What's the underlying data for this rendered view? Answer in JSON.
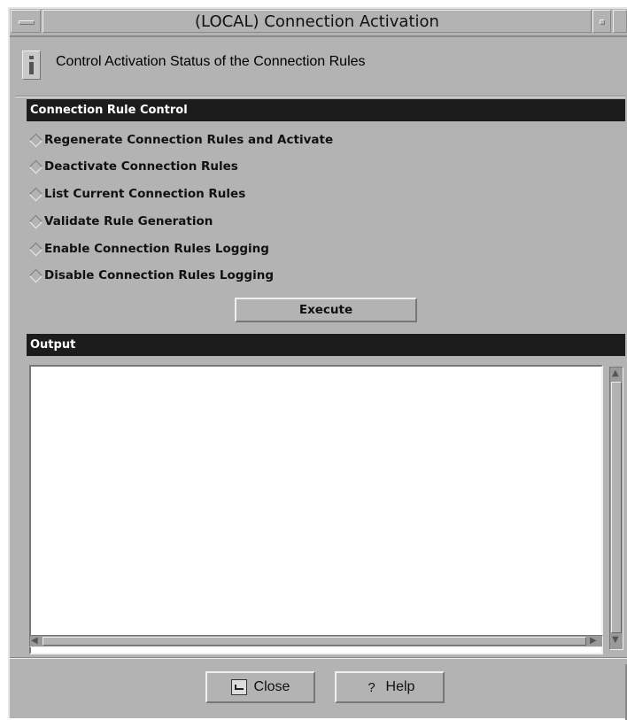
{
  "window": {
    "title": "(LOCAL) Connection Activation"
  },
  "header": {
    "text": "Control Activation Status of the Connection Rules",
    "icon": "info-icon"
  },
  "control_section": {
    "title": "Connection Rule Control",
    "options": [
      "Regenerate Connection Rules and Activate",
      "Deactivate Connection Rules",
      "List Current Connection Rules",
      "Validate Rule Generation",
      "Enable Connection Rules Logging",
      "Disable Connection Rules Logging"
    ],
    "execute_label": "Execute"
  },
  "output_section": {
    "title": "Output",
    "value": ""
  },
  "footer": {
    "close_label": "Close",
    "help_label": "Help"
  },
  "colors": {
    "window_bg": "#b3b3b3",
    "section_header_bg": "#1c1c1c",
    "section_header_text": "#ffffff"
  }
}
